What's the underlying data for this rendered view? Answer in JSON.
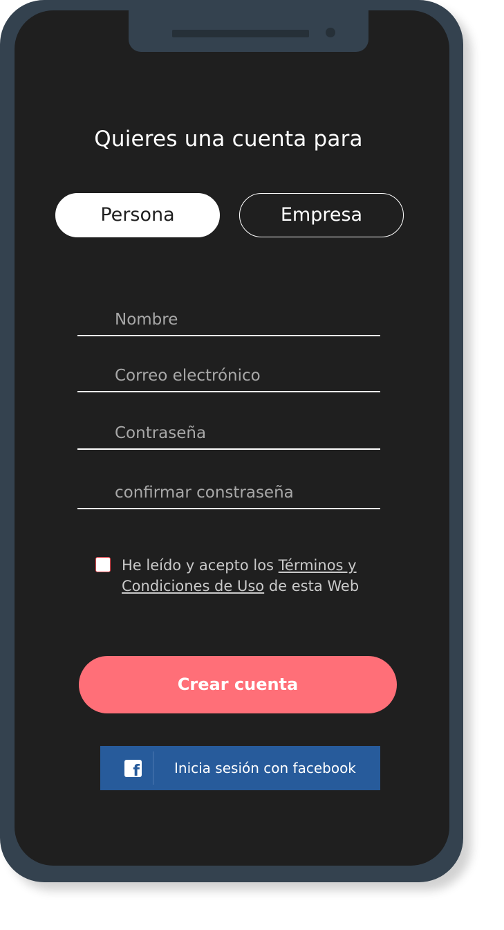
{
  "form": {
    "title": "Quieres una cuenta para",
    "account_type": {
      "options": [
        "Persona",
        "Empresa"
      ],
      "selected": "Persona"
    },
    "fields": {
      "name_placeholder": "Nombre",
      "email_placeholder": "Correo electrónico",
      "password_placeholder": "Contraseña",
      "confirm_password_placeholder": "confirmar constraseña"
    },
    "terms": {
      "prefix": "He leído y acepto los ",
      "link": "Términos y Condiciones de Uso",
      "suffix": " de esta Web",
      "checked": false
    },
    "create_button_label": "Crear cuenta",
    "facebook_button_label": "Inicia sesión con facebook"
  },
  "colors": {
    "screen_background": "#1f1f1f",
    "device_frame": "#34424f",
    "accent": "#ff6f78",
    "facebook_blue": "#275b9b"
  },
  "icons": {
    "facebook": "facebook-icon"
  }
}
